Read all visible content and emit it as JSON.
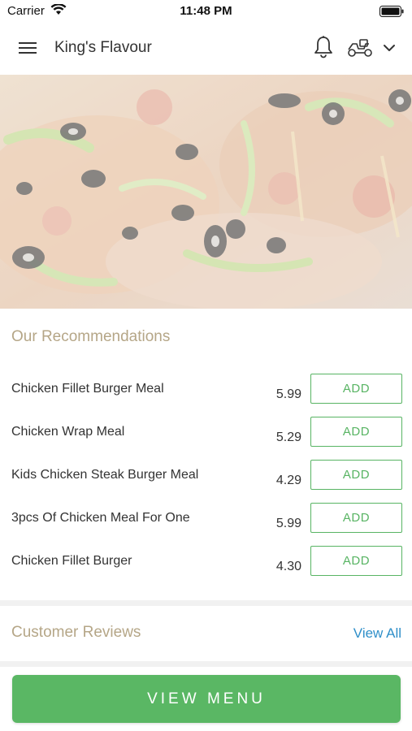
{
  "status_bar": {
    "carrier": "Carrier",
    "time": "11:48 PM"
  },
  "header": {
    "title": "King's Flavour"
  },
  "hero": {
    "alt": "pizza-photo"
  },
  "recommendations": {
    "title": "Our Recommendations",
    "add_label": "ADD",
    "items": [
      {
        "name": "Chicken Fillet Burger Meal",
        "price": "5.99"
      },
      {
        "name": "Chicken Wrap Meal",
        "price": "5.29"
      },
      {
        "name": "Kids Chicken Steak Burger Meal",
        "price": "4.29"
      },
      {
        "name": "3pcs Of Chicken Meal For One",
        "price": "5.99"
      },
      {
        "name": "Chicken Fillet Burger",
        "price": "4.30"
      }
    ]
  },
  "reviews": {
    "title": "Customer Reviews",
    "view_all": "View All"
  },
  "footer": {
    "view_menu": "VIEW MENU"
  },
  "colors": {
    "accent_green": "#58b463",
    "section_title": "#b5a687",
    "link_blue": "#2f8fc9"
  },
  "icons": [
    "wifi-icon",
    "battery-icon",
    "hamburger-menu-icon",
    "bell-icon",
    "delivery-scooter-icon",
    "chevron-down-icon"
  ]
}
